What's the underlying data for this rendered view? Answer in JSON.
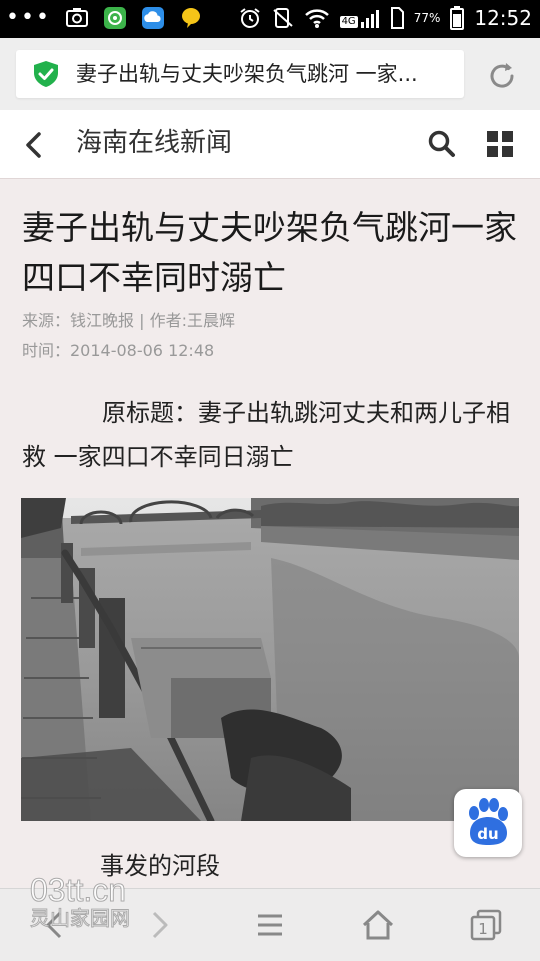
{
  "status_bar": {
    "battery_percent": "77%",
    "network": "4G",
    "time": "12:52"
  },
  "url_bar": {
    "page_title": "妻子出轨与丈夫吵架负气跳河 一家..."
  },
  "site_header": {
    "title": "海南在线新闻"
  },
  "article": {
    "headline": "妻子出轨与丈夫吵架负气跳河一家四口不幸同时溺亡",
    "source_line": "来源：钱江晚报 | 作者:王晨辉",
    "time_line": "时间：2014-08-06 12:48",
    "paragraph": "原标题：妻子出轨跳河丈夫和两儿子相救 一家四口不幸同日溺亡",
    "caption": "事发的河段"
  },
  "watermark": {
    "line1": "03tt.cn",
    "line2": "灵山家园网"
  },
  "bottom_nav": {
    "tab_count": "1"
  },
  "colors": {
    "shield_green": "#22b14c",
    "page_bg": "#f2ecec",
    "baidu_blue": "#2f6fe0"
  }
}
